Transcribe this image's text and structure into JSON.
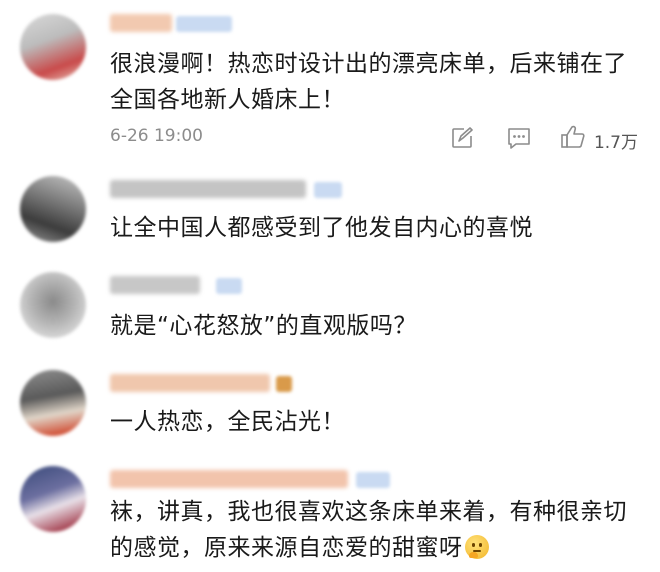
{
  "comments": [
    {
      "text": "很浪漫啊！热恋时设计出的漂亮床单，后来铺在了全国各地新人婚床上！",
      "time": "6-26 19:00",
      "likes": "1.7万"
    },
    {
      "text": "让全中国人都感受到了他发自内心的喜悦"
    },
    {
      "text": "就是“心花怒放”的直观版吗？"
    },
    {
      "text": "一人热恋，全民沾光！"
    },
    {
      "text": "袜，讲真，我也很喜欢这条床单来着，有种很亲切的感觉，原来来源自恋爱的甜蜜呀",
      "emoji": "thinking-face-icon"
    }
  ],
  "icons": {
    "share": "share-edit-icon",
    "comment": "comment-icon",
    "like": "thumbs-up-icon"
  },
  "colors": {
    "text": "#1a1a1a",
    "meta": "#8c8c8c"
  }
}
